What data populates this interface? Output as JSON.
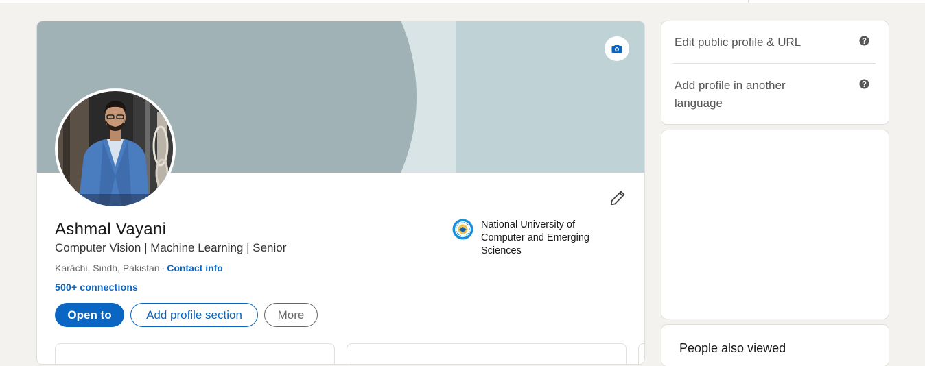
{
  "profile": {
    "name": "Ashmal Vayani",
    "headline": "Computer Vision | Machine Learning | Senior",
    "location": "Karāchi, Sindh, Pakistan",
    "separator": "·",
    "contact_info": "Contact info",
    "connections": "500+ connections",
    "school": "National University of Computer and Emerging Sciences",
    "actions": {
      "open_to": "Open to",
      "add_section": "Add profile section",
      "more": "More"
    }
  },
  "sidebar": {
    "edit_public_profile": "Edit public profile & URL",
    "add_profile_language": "Add profile in another language",
    "next_section_title": "People also viewed"
  },
  "colors": {
    "accent": "#0a66c2",
    "banner": "#bfd2d6",
    "banner_dark": "#a0b2b6",
    "page_bg": "#f3f2ef"
  },
  "icons": [
    "camera-icon",
    "pencil-icon",
    "help-icon",
    "school-logo"
  ]
}
